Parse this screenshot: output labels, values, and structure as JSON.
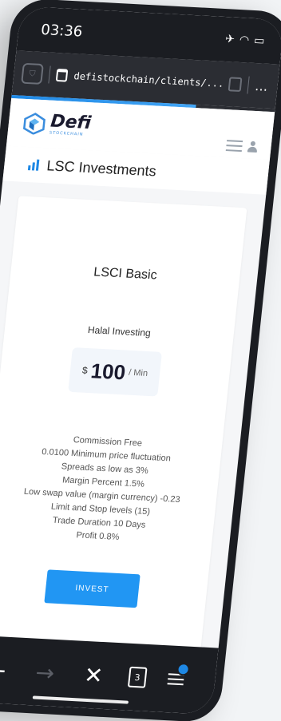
{
  "status": {
    "time": "03:36"
  },
  "browser": {
    "url": "defistockchain/clients/...",
    "tab_count": "3"
  },
  "header": {
    "logo_text": "Defi",
    "logo_sub": "STOCKCHAIN"
  },
  "section": {
    "title": "LSC Investments"
  },
  "plan": {
    "name": "LSCI Basic",
    "subtitle": "Halal Investing",
    "price": {
      "currency": "$",
      "value": "100",
      "suffix": "/ Min"
    },
    "features": [
      "Commission Free",
      "0.0100 Minimum price fluctuation",
      "Spreads as low as 3%",
      "Margin Percent 1.5%",
      "Low swap value (margin currency) -0.23",
      "Limit and Stop levels (15)",
      "Trade Duration 10 Days",
      "Profit 0.8%"
    ],
    "cta": "INVEST"
  },
  "colors": {
    "accent": "#2196f3",
    "dark": "#1b1d22"
  },
  "icons": [
    "shield-icon",
    "lock-icon",
    "tabs-icon",
    "more-icon",
    "hamburger-icon",
    "user-icon",
    "chart-icon",
    "back-arrow-icon",
    "forward-arrow-icon",
    "close-icon",
    "menu-icon"
  ]
}
